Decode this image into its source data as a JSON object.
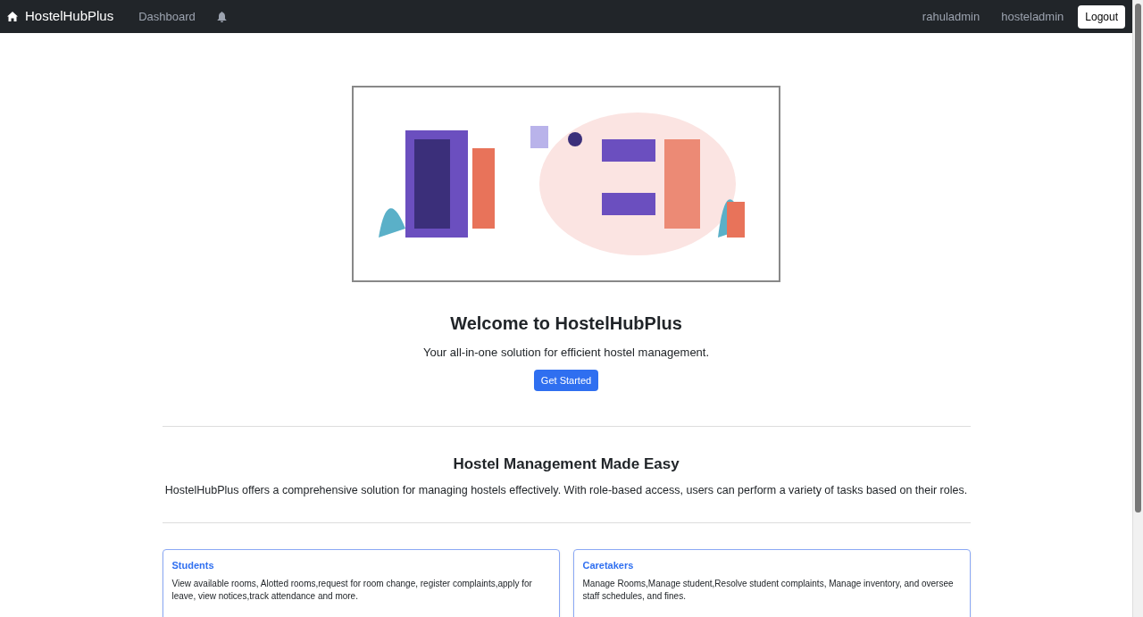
{
  "navbar": {
    "brand": "HostelHubPlus",
    "links": [
      "Dashboard"
    ],
    "users": [
      "rahuladmin",
      "hosteladmin"
    ],
    "logout": "Logout"
  },
  "hero": {
    "title": "Welcome to HostelHubPlus",
    "subtitle": "Your all-in-one solution for efficient hostel management.",
    "button": "Get Started"
  },
  "about": {
    "title": "Hostel Management Made Easy",
    "text": "HostelHubPlus offers a comprehensive solution for managing hostels effectively. With role-based access, users can perform a variety of tasks based on their roles."
  },
  "cards": [
    {
      "title": "Students",
      "text": "View available rooms, Alotted rooms,request for room change, register complaints,apply for leave, view notices,track attendance and more."
    },
    {
      "title": "Caretakers",
      "text": "Manage Rooms,Manage student,Resolve student complaints, Manage inventory, and oversee staff schedules, and fines."
    }
  ]
}
